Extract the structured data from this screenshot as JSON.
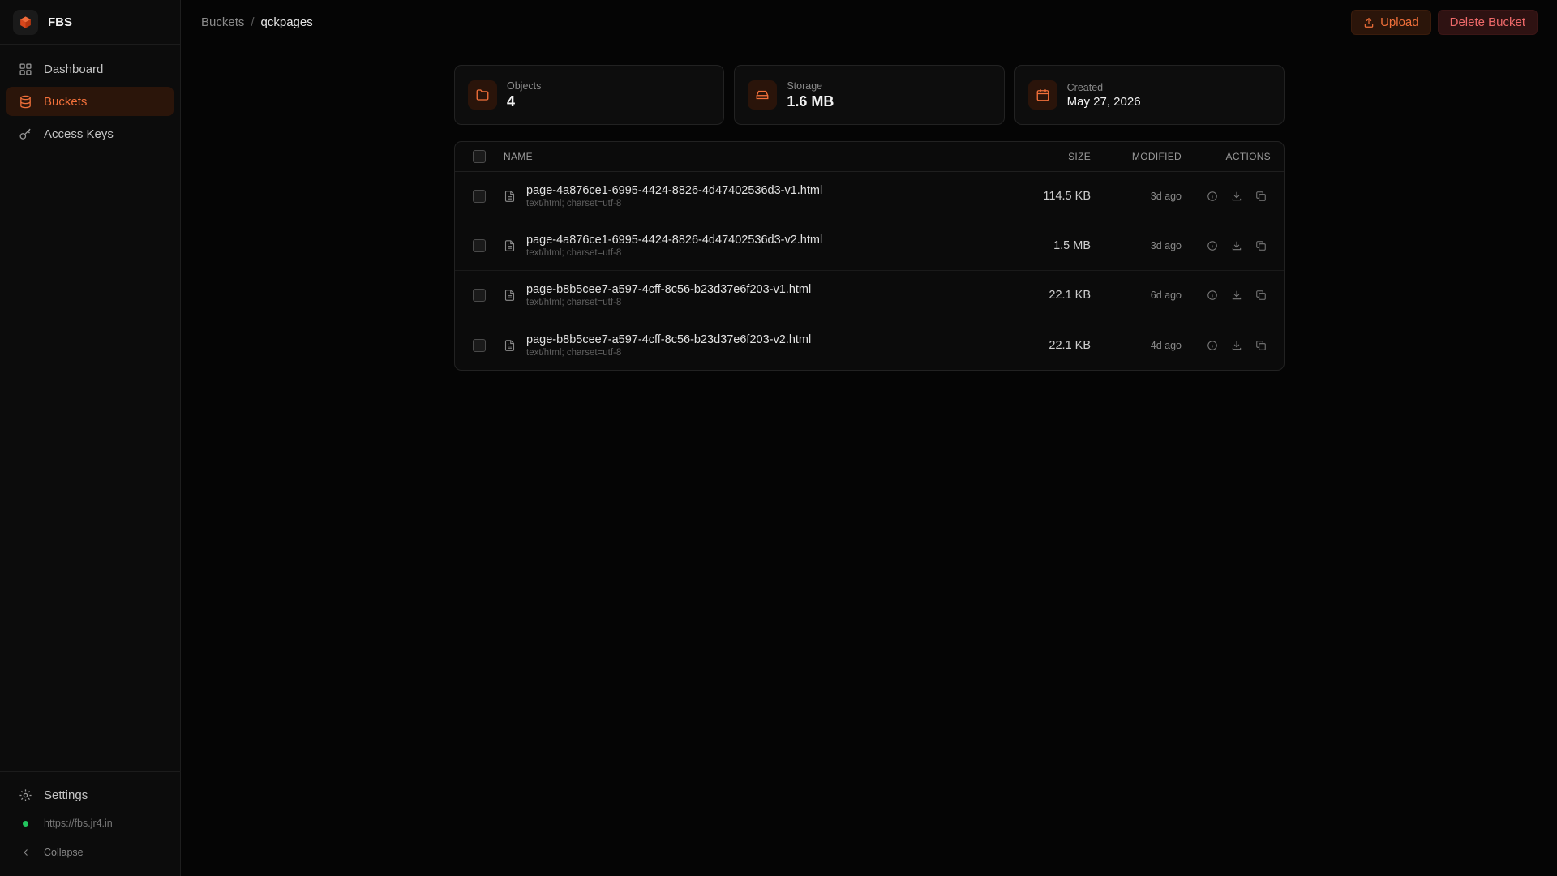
{
  "brand": {
    "name": "FBS"
  },
  "sidebar": {
    "items": [
      {
        "label": "Dashboard",
        "icon": "grid-icon"
      },
      {
        "label": "Buckets",
        "icon": "database-icon",
        "active": true
      },
      {
        "label": "Access Keys",
        "icon": "key-icon"
      }
    ],
    "settings_label": "Settings",
    "server_url": "https://fbs.jr4.in",
    "collapse_label": "Collapse"
  },
  "header": {
    "breadcrumb_root": "Buckets",
    "breadcrumb_sep": "/",
    "breadcrumb_current": "qckpages",
    "upload_label": "Upload",
    "delete_label": "Delete Bucket"
  },
  "stats": {
    "objects": {
      "label": "Objects",
      "value": "4"
    },
    "storage": {
      "label": "Storage",
      "value": "1.6 MB"
    },
    "created": {
      "label": "Created",
      "value": "May 27, 2026"
    }
  },
  "table": {
    "headers": {
      "name": "NAME",
      "size": "SIZE",
      "modified": "MODIFIED",
      "actions": "ACTIONS"
    },
    "rows": [
      {
        "name": "page-4a876ce1-6995-4424-8826-4d47402536d3-v1.html",
        "type": "text/html; charset=utf-8",
        "size": "114.5 KB",
        "modified": "3d ago"
      },
      {
        "name": "page-4a876ce1-6995-4424-8826-4d47402536d3-v2.html",
        "type": "text/html; charset=utf-8",
        "size": "1.5 MB",
        "modified": "3d ago"
      },
      {
        "name": "page-b8b5cee7-a597-4cff-8c56-b23d37e6f203-v1.html",
        "type": "text/html; charset=utf-8",
        "size": "22.1 KB",
        "modified": "6d ago"
      },
      {
        "name": "page-b8b5cee7-a597-4cff-8c56-b23d37e6f203-v2.html",
        "type": "text/html; charset=utf-8",
        "size": "22.1 KB",
        "modified": "4d ago"
      }
    ]
  },
  "colors": {
    "accent": "#f2703a",
    "danger": "#f06a6a",
    "status_online": "#22c55e"
  }
}
